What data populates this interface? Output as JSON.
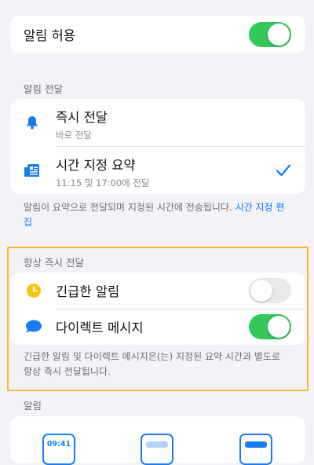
{
  "allow": {
    "label": "알림 허용",
    "on": true
  },
  "delivery": {
    "header": "알림 전달",
    "immediate": {
      "title": "즉시 전달",
      "subtitle": "바로 전달",
      "icon": "bell-icon"
    },
    "scheduled": {
      "title": "시간 지정 요약",
      "subtitle": "11:15 및 17:00에 전달",
      "icon": "summary-icon",
      "checked": true
    },
    "footnote": "알림이 요약으로 전달되며 지정된 시간에 전송됩니다. ",
    "footnote_link": "시간 지정 편집"
  },
  "always": {
    "header": "항상 즉시 전달",
    "urgent": {
      "label": "긴급한 알림",
      "on": false,
      "icon": "clock-icon"
    },
    "dm": {
      "label": "다이렉트 메시지",
      "on": true,
      "icon": "chat-bubble-icon"
    },
    "footnote": "긴급한 알림 및 다이렉트 메시지은(는) 지정된 요약 시간과 별도로 항상 즉시 전달됩니다."
  },
  "alerts": {
    "header": "알림",
    "lock_screen_time": "09:41"
  },
  "colors": {
    "accent": "#0a7aff",
    "toggle_on": "#34c759",
    "highlight": "#f7b733"
  }
}
